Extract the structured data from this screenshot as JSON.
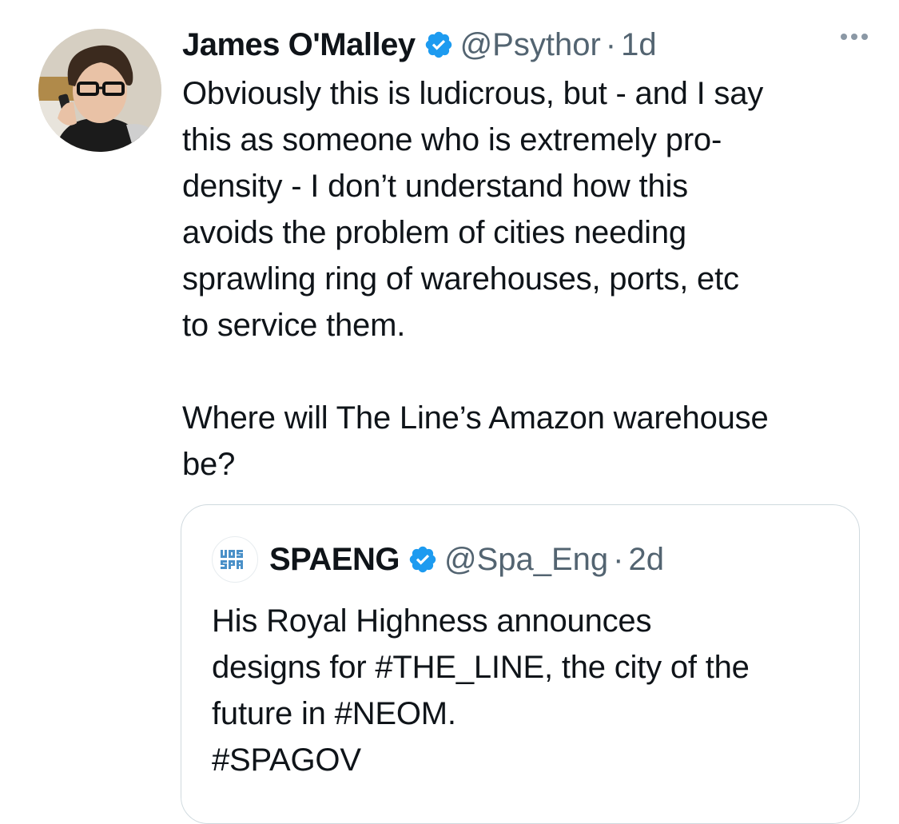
{
  "tweet": {
    "author": {
      "display_name": "James O'Malley",
      "handle": "@Psythor",
      "verified": true,
      "avatar_icon": "user-photo-avatar"
    },
    "separator": "·",
    "time": "1d",
    "more_icon": "more-horizontal-icon",
    "text": "Obviously this is ludicrous, but - and I say\nthis as someone who is extremely pro-\ndensity - I don’t understand how this\navoids the problem of cities needing\nsprawling ring of warehouses, ports, etc\nto service them.\n\nWhere will The Line’s Amazon warehouse\nbe?"
  },
  "quoted_tweet": {
    "author": {
      "display_name": "SPAENG",
      "handle": "@Spa_Eng",
      "verified": true,
      "avatar_icon": "spa-logo-avatar"
    },
    "separator": "·",
    "time": "2d",
    "text": "His Royal Highness announces\ndesigns for #THE_LINE, the city of the\nfuture in #NEOM.\n#SPAGOV"
  },
  "colors": {
    "text_primary": "#0f1419",
    "text_secondary": "#536471",
    "verified_blue": "#1d9bf0",
    "border": "#cfd9de"
  }
}
